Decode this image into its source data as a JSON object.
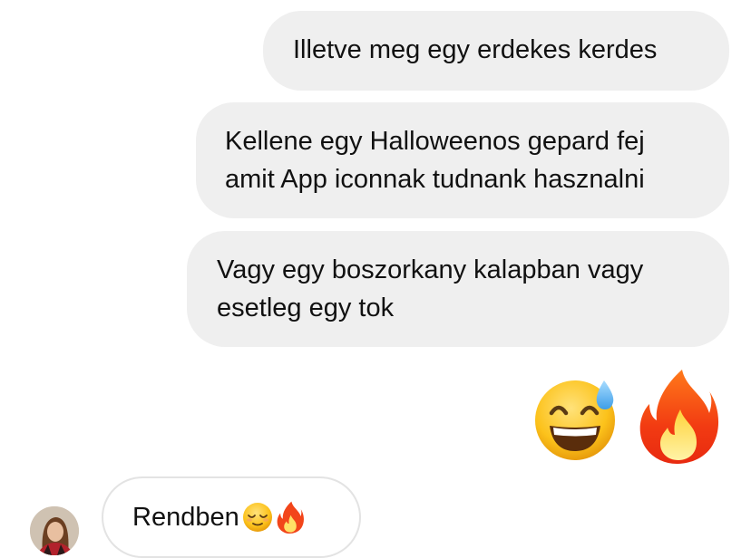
{
  "messages_outgoing": [
    {
      "lines": [
        "Illetve meg egy erdekes kerdes"
      ]
    },
    {
      "lines": [
        "Kellene egy Halloweenos gepard fej",
        "amit App iconnak tudnank hasznalni"
      ]
    },
    {
      "lines": [
        "Vagy egy boszorkany kalapban vagy",
        "esetleg egy tok"
      ]
    }
  ],
  "reactions": {
    "emoji_1": "sweat-smile-emoji",
    "emoji_2": "fire-emoji"
  },
  "incoming": {
    "text": "Rendben",
    "emojis": [
      "relieved-face-emoji",
      "fire-emoji"
    ]
  },
  "colors": {
    "outgoing_bubble": "#efefef",
    "incoming_border": "#e3e3e3",
    "text": "#111111"
  }
}
